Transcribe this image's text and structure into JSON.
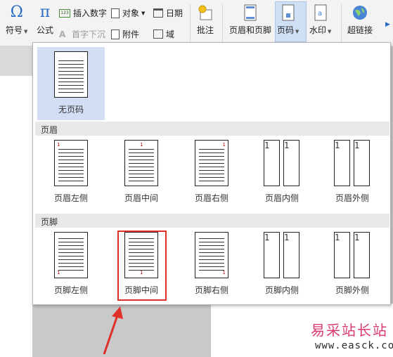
{
  "ribbon": {
    "symbol": {
      "glyph": "Ω",
      "label": "符号"
    },
    "formula": {
      "glyph": "π",
      "label": "公式"
    },
    "insert_number": {
      "icon_text": "123",
      "label": "插入数字"
    },
    "drop_cap": {
      "label": "首字下沉"
    },
    "object": {
      "label": "对象"
    },
    "attachment": {
      "label": "附件"
    },
    "date": {
      "label": "日期"
    },
    "field": {
      "label": "域"
    },
    "comment": {
      "label": "批注"
    },
    "header_footer": {
      "label": "页眉和页脚"
    },
    "page_number": {
      "label": "页码"
    },
    "watermark": {
      "label": "水印"
    },
    "hyperlink": {
      "label": "超链接"
    }
  },
  "dropdown": {
    "none_option": {
      "label": "无页码"
    },
    "header_section": {
      "title": "页眉",
      "options": [
        {
          "label": "页眉左侧",
          "page_number": "1"
        },
        {
          "label": "页眉中间",
          "page_number": "1"
        },
        {
          "label": "页眉右侧",
          "page_number": "1"
        },
        {
          "label": "页眉内侧",
          "page_number": "1"
        },
        {
          "label": "页眉外侧",
          "page_number": "1"
        }
      ]
    },
    "footer_section": {
      "title": "页脚",
      "options": [
        {
          "label": "页脚左侧",
          "page_number": "1"
        },
        {
          "label": "页脚中间",
          "page_number": "1"
        },
        {
          "label": "页脚右侧",
          "page_number": "1"
        },
        {
          "label": "页脚内侧",
          "page_number": "1"
        },
        {
          "label": "页脚外侧",
          "page_number": "1"
        }
      ]
    }
  },
  "watermark_overlay": {
    "cn": "易采站长站",
    "url": "www.easck.com"
  },
  "colors": {
    "accent_red": "#e0302a",
    "selected_bg": "#d2def3",
    "ribbon_active": "#cfe0f5"
  }
}
